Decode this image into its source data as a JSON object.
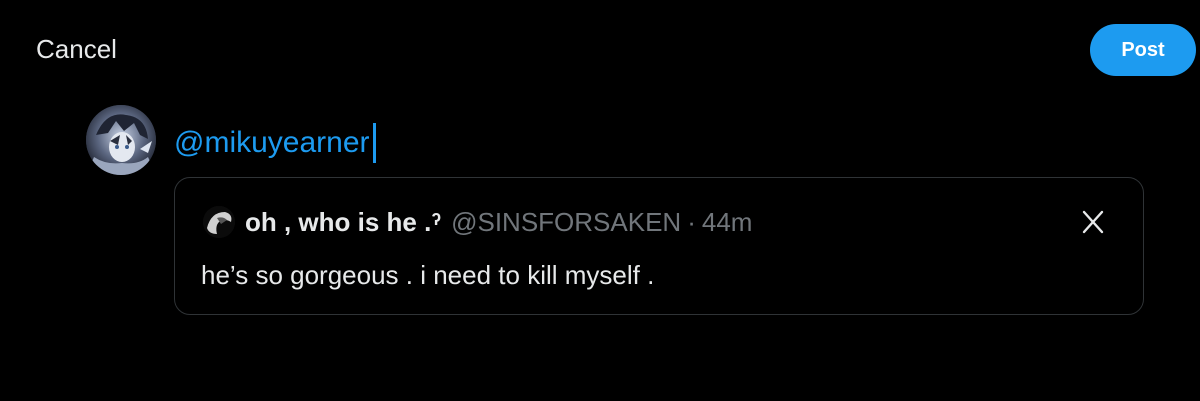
{
  "header": {
    "cancel_label": "Cancel",
    "post_label": "Post"
  },
  "composer": {
    "text": "@mikuyearner"
  },
  "quote": {
    "display_name": "oh , who is he .ˀ",
    "handle": "@SINSFORSAKEN",
    "separator": "·",
    "time": "44m",
    "text": "he’s so gorgeous . i need to kill myself ."
  },
  "colors": {
    "background": "#000000",
    "accent": "#1d9bf0",
    "text_primary": "#e7e9ea",
    "text_secondary": "#71767b",
    "border": "#2f3336"
  },
  "icons": {
    "remove_quote": "close-icon"
  }
}
